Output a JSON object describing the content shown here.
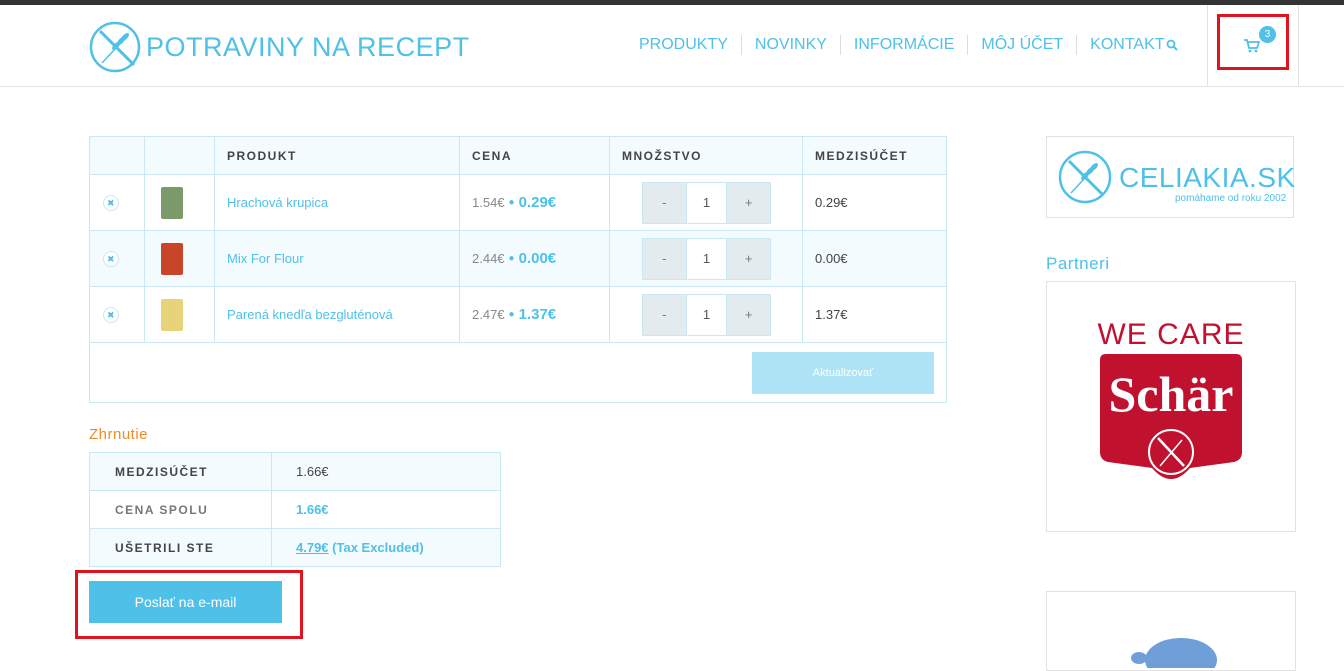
{
  "site": {
    "logo_text": "POTRAVINY NA RECEPT"
  },
  "nav": {
    "items": [
      "PRODUKTY",
      "NOVINKY",
      "INFORMÁCIE",
      "MÔJ ÚČET",
      "KONTAKT"
    ],
    "cart_count": "3"
  },
  "cart": {
    "headers": {
      "product": "PRODUKT",
      "price": "CENA",
      "quantity": "MNOŽSTVO",
      "subtotal": "MEDZISÚČET"
    },
    "rows": [
      {
        "name": "Hrachová krupica",
        "old_price": "1.54€",
        "new_price": "0.29€",
        "qty": "1",
        "subtotal": "0.29€",
        "thumb_color": "#7a9a6a"
      },
      {
        "name": "Mix For Flour",
        "old_price": "2.44€",
        "new_price": "0.00€",
        "qty": "1",
        "subtotal": "0.00€",
        "thumb_color": "#c9452a"
      },
      {
        "name": "Parená knedľa bezgluténová",
        "old_price": "2.47€",
        "new_price": "1.37€",
        "qty": "1",
        "subtotal": "1.37€",
        "thumb_color": "#e8d27a"
      }
    ],
    "minus": "-",
    "plus": "+",
    "update_label": "Aktualizovať"
  },
  "summary": {
    "title": "Zhrnutie",
    "subtotal_label": "MEDZISÚČET",
    "subtotal_value": "1.66€",
    "total_label": "CENA SPOLU",
    "total_value": "1.66€",
    "saved_label": "UŠETRILI STE",
    "saved_value": "4.79€",
    "saved_note": " (Tax Excluded)"
  },
  "email_button": "Poslať na e-mail",
  "sidebar": {
    "celiakia_text": "CELIAKIA.SK",
    "celiakia_sub": "pomáhame od roku 2002",
    "partners_title": "Partneri",
    "schar_tagline": "WE CARE",
    "schar_name": "Schär"
  },
  "colors": {
    "accent": "#4fc0e8",
    "summary_title": "#f08a24",
    "highlight": "#e0141e"
  }
}
